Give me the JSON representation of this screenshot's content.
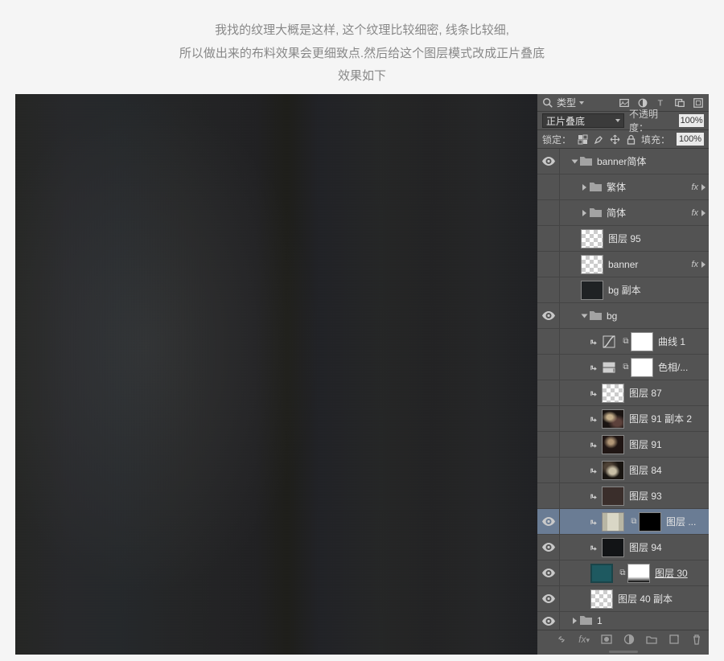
{
  "caption": {
    "l1": "我找的纹理大概是这样, 这个纹理比较细密, 线条比较细,",
    "l2": "所以做出来的布料效果会更细致点.然后给这个图层模式改成正片叠底",
    "l3": "效果如下"
  },
  "panel": {
    "filter_label": "类型",
    "blend_mode": "正片叠底",
    "opacity_label": "不透明度：",
    "opacity_value": "100%",
    "lock_label": "锁定：",
    "fill_label": "填充：",
    "fill_value": "100%",
    "fx_label": "fx"
  },
  "layers": [
    {
      "kind": "group",
      "open": true,
      "name": "banner简体",
      "indent": 0,
      "vis": true,
      "fx": false
    },
    {
      "kind": "group",
      "open": false,
      "name": "繁体",
      "indent": 1,
      "vis": false,
      "fx": true
    },
    {
      "kind": "group",
      "open": false,
      "name": "简体",
      "indent": 1,
      "vis": false,
      "fx": true
    },
    {
      "kind": "layer",
      "thumb": "trans",
      "name": "图层 95",
      "indent": 1,
      "vis": false
    },
    {
      "kind": "layer",
      "thumb": "trans",
      "name": "banner",
      "indent": 1,
      "vis": false,
      "fx": true
    },
    {
      "kind": "layer",
      "thumb": "dark",
      "name": "bg 副本",
      "indent": 1,
      "vis": false
    },
    {
      "kind": "group",
      "open": true,
      "name": "bg",
      "indent": 1,
      "vis": true
    },
    {
      "kind": "adj",
      "adj": "curves",
      "mask": "white",
      "name": "曲线 1",
      "indent": 2,
      "vis": false,
      "clip": true
    },
    {
      "kind": "adj",
      "adj": "huesat",
      "mask": "white",
      "name": "色相/...",
      "indent": 2,
      "vis": false,
      "clip": true
    },
    {
      "kind": "layer",
      "thumb": "trans",
      "name": "图层 87",
      "indent": 2,
      "vis": false,
      "clip": true
    },
    {
      "kind": "layer",
      "thumb": "photo1",
      "name": "图层 91 副本 2",
      "indent": 2,
      "vis": false,
      "clip": true
    },
    {
      "kind": "layer",
      "thumb": "photo2",
      "name": "图层 91",
      "indent": 2,
      "vis": false,
      "clip": true
    },
    {
      "kind": "layer",
      "thumb": "photo3",
      "name": "图层 84",
      "indent": 2,
      "vis": false,
      "clip": true
    },
    {
      "kind": "layer",
      "thumb": "dark3",
      "name": "图层 93",
      "indent": 2,
      "vis": false,
      "clip": true
    },
    {
      "kind": "layerm",
      "thumb": "sel-t",
      "mask": "black",
      "name": "图层 ...",
      "indent": 2,
      "vis": true,
      "clip": true,
      "sel": true
    },
    {
      "kind": "layer",
      "thumb": "dark2",
      "name": "图层 94",
      "indent": 2,
      "vis": true,
      "clip": true
    },
    {
      "kind": "layerm",
      "thumb": "teal",
      "mask": "grad",
      "name": "图层 30",
      "indent": 2,
      "vis": true,
      "und": true
    },
    {
      "kind": "layer",
      "thumb": "trans",
      "name": "图层 40 副本",
      "indent": 2,
      "vis": true
    },
    {
      "kind": "group",
      "open": false,
      "name": "1",
      "indent": 0,
      "vis": true,
      "short": true
    }
  ]
}
